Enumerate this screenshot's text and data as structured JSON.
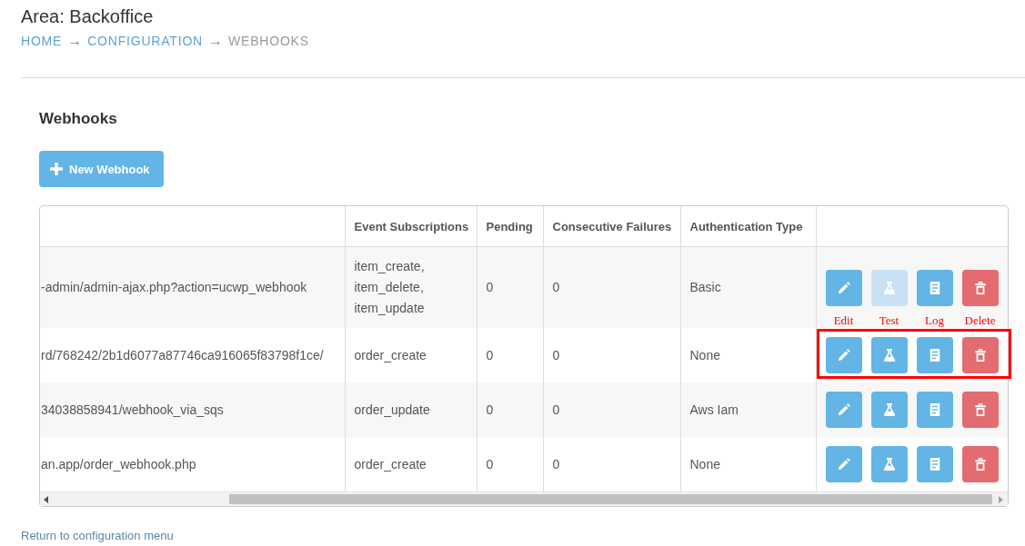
{
  "page": {
    "title": "Area: Backoffice"
  },
  "breadcrumb": [
    {
      "kind": "link",
      "label": "HOME"
    },
    {
      "kind": "separator",
      "label": "→"
    },
    {
      "kind": "link",
      "label": "CONFIGURATION"
    },
    {
      "kind": "separator",
      "label": "→"
    },
    {
      "kind": "current",
      "label": "WEBHOOKS"
    }
  ],
  "section": {
    "heading": "Webhooks",
    "new_button": {
      "label": "New Webhook"
    }
  },
  "table": {
    "columns": [
      "Event Subscriptions",
      "Pending",
      "Consecutive Failures",
      "Authentication Type"
    ],
    "rows": [
      {
        "column_1": "-admin/admin-ajax.php?action=ucwp_webhook",
        "cells": [
          "item_create, item_delete, item_update",
          "0",
          "0",
          "Basic"
        ],
        "highlighted": false,
        "actions": [
          {
            "kind": "edit",
            "disabled": false,
            "callout": "Edit"
          },
          {
            "kind": "test",
            "disabled": true,
            "callout": "Test"
          },
          {
            "kind": "log",
            "disabled": false,
            "callout": "Log"
          },
          {
            "kind": "delete",
            "disabled": false,
            "callout": "Delete"
          }
        ]
      },
      {
        "column_1": "rd/768242/2b1d6077a87746ca916065f83798f1ce/",
        "cells": [
          "order_create",
          "0",
          "0",
          "None"
        ],
        "highlighted": true,
        "actions": [
          {
            "kind": "edit",
            "disabled": false
          },
          {
            "kind": "test",
            "disabled": false
          },
          {
            "kind": "log",
            "disabled": false
          },
          {
            "kind": "delete",
            "disabled": false
          }
        ]
      },
      {
        "column_1": "34038858941/webhook_via_sqs",
        "cells": [
          "order_update",
          "0",
          "0",
          "Aws Iam"
        ],
        "highlighted": false,
        "actions": [
          {
            "kind": "edit",
            "disabled": false
          },
          {
            "kind": "test",
            "disabled": false
          },
          {
            "kind": "log",
            "disabled": false
          },
          {
            "kind": "delete",
            "disabled": false
          }
        ]
      },
      {
        "column_1": "an.app/order_webhook.php",
        "cells": [
          "order_create",
          "0",
          "0",
          "None"
        ],
        "highlighted": false,
        "actions": [
          {
            "kind": "edit",
            "disabled": false
          },
          {
            "kind": "test",
            "disabled": false
          },
          {
            "kind": "log",
            "disabled": false
          },
          {
            "kind": "delete",
            "disabled": false
          }
        ]
      }
    ]
  },
  "footer_link": {
    "label": "Return to configuration menu"
  }
}
